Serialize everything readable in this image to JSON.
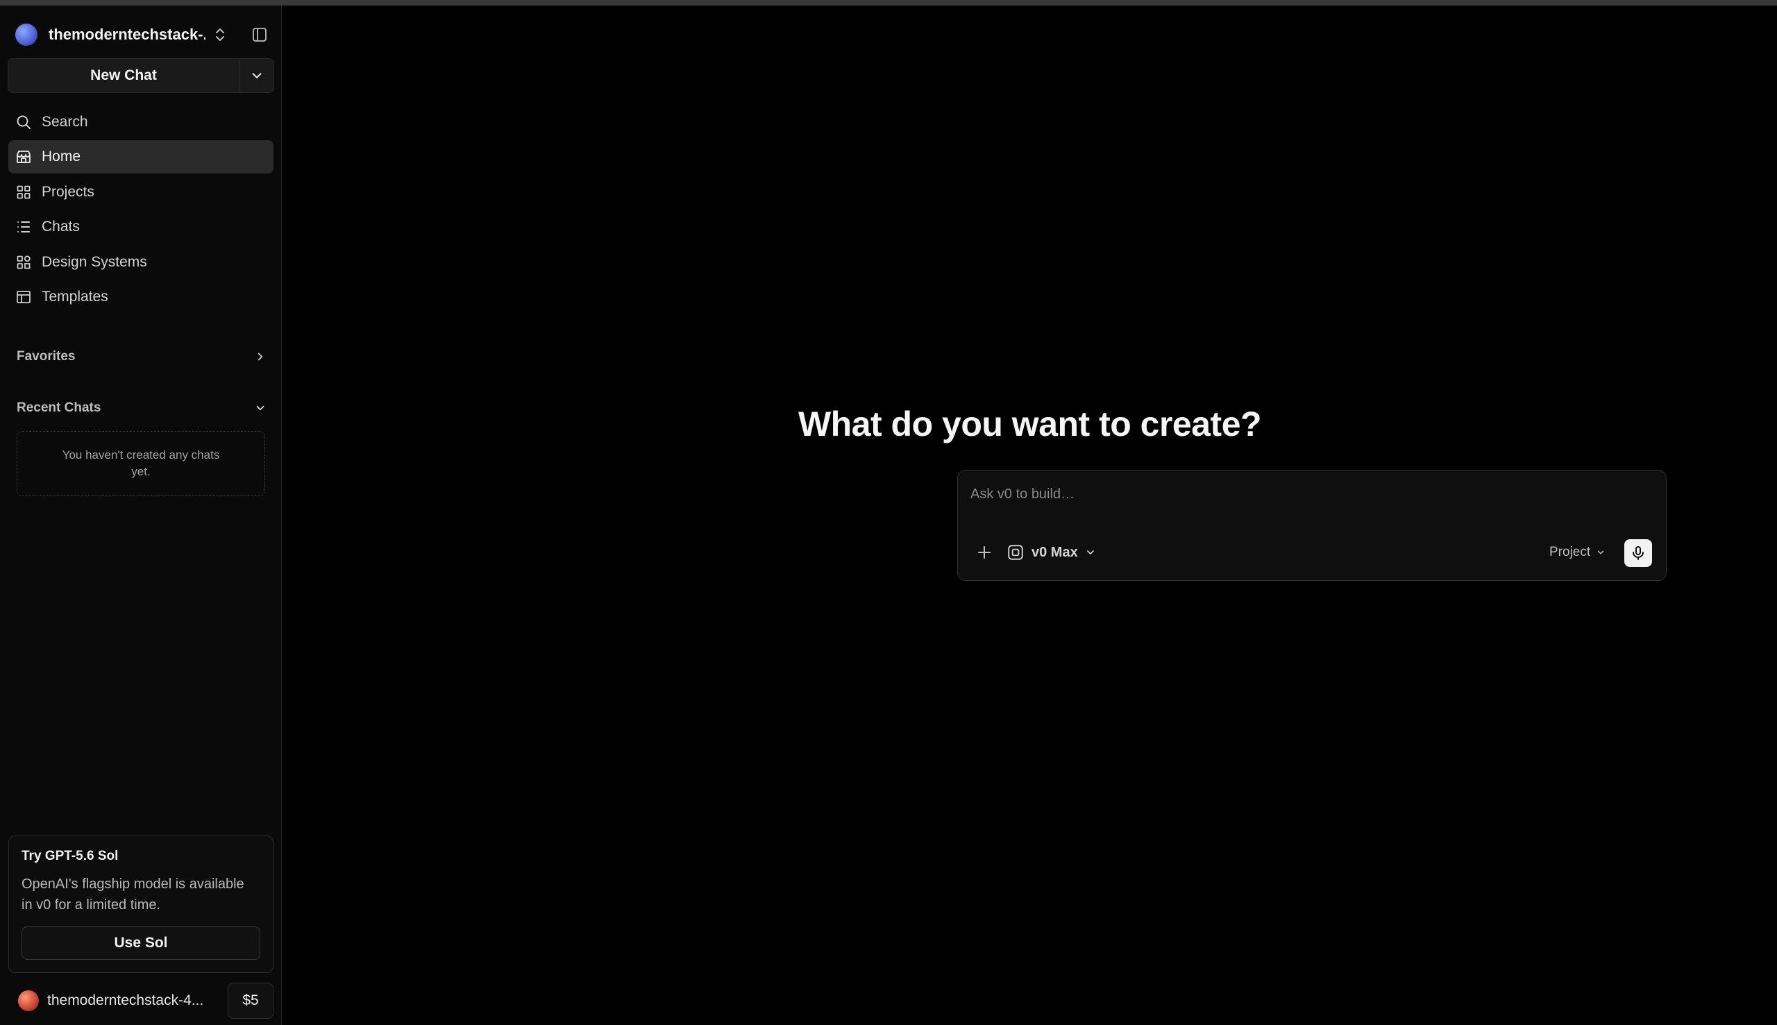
{
  "workspace": {
    "name": "themoderntechstack-..."
  },
  "new_chat": {
    "label": "New Chat"
  },
  "nav": {
    "items": [
      {
        "label": "Search",
        "icon": "search-icon"
      },
      {
        "label": "Home",
        "icon": "home-icon",
        "active": true
      },
      {
        "label": "Projects",
        "icon": "grid-icon"
      },
      {
        "label": "Chats",
        "icon": "list-icon"
      },
      {
        "label": "Design Systems",
        "icon": "design-system-icon"
      },
      {
        "label": "Templates",
        "icon": "template-icon"
      }
    ]
  },
  "favorites": {
    "label": "Favorites"
  },
  "recent": {
    "label": "Recent Chats",
    "empty_text": "You haven't created any chats yet."
  },
  "promo": {
    "title": "Try GPT-5.6 Sol",
    "body": "OpenAI's flagship model is available in v0 for a limited time.",
    "button": "Use Sol"
  },
  "user": {
    "name": "themoderntechstack-4...",
    "credits": "$5"
  },
  "main": {
    "heading": "What do you want to create?",
    "composer": {
      "placeholder": "Ask v0 to build…",
      "model": "v0 Max",
      "project": "Project"
    }
  },
  "colors": {
    "background": "#000000",
    "sidebar": "#0a0a0a",
    "active_item": "#2a2a2a",
    "mic_button": "#f2f2f2"
  }
}
